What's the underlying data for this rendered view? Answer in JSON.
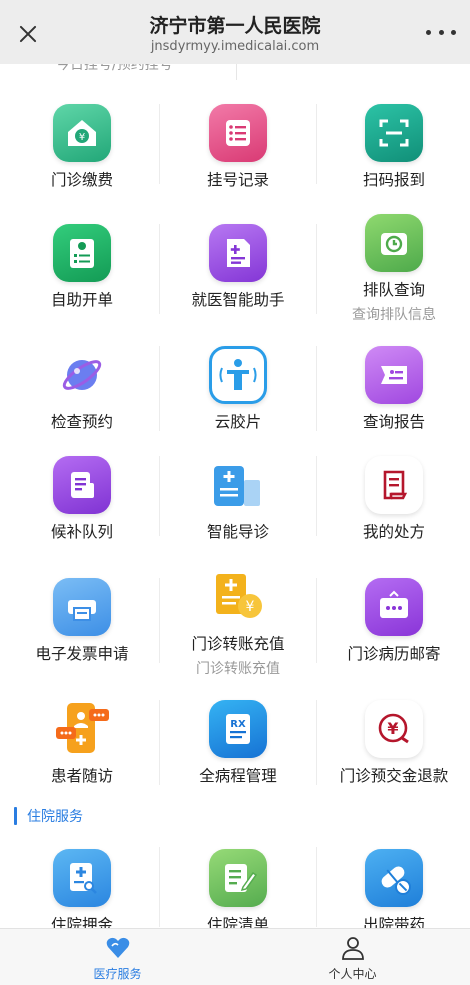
{
  "header": {
    "title": "济宁市第一人民医院",
    "url": "jnsdyrmyy.imedicalai.com"
  },
  "top_partial": {
    "text": "今日挂号/预约挂号"
  },
  "services": [
    {
      "label": "门诊缴费",
      "icon": "payment-house-icon",
      "color": "#3dbf8f"
    },
    {
      "label": "挂号记录",
      "icon": "record-list-icon",
      "color": "#e8538a"
    },
    {
      "label": "扫码报到",
      "icon": "scan-icon",
      "color": "#1aaa8e"
    },
    {
      "label": "自助开单",
      "icon": "checklist-card-icon",
      "color": "#22b066"
    },
    {
      "label": "就医智能助手",
      "icon": "document-plus-icon",
      "color": "#9a4ee3"
    },
    {
      "label": "排队查询",
      "sub": "查询排队信息",
      "icon": "clock-folder-icon",
      "color": "#6cc36b"
    },
    {
      "label": "检查预约",
      "icon": "planet-icon",
      "color": "#5b6ee8"
    },
    {
      "label": "云胶片",
      "icon": "body-scan-icon",
      "color": "#2a9de8"
    },
    {
      "label": "查询报告",
      "icon": "report-card-icon",
      "color": "#b25ee6"
    },
    {
      "label": "候补队列",
      "icon": "queue-document-icon",
      "color": "#9b48e0"
    },
    {
      "label": "智能导诊",
      "icon": "hospital-building-icon",
      "color": "#3b9ce8"
    },
    {
      "label": "我的处方",
      "icon": "prescription-icon",
      "color": "#c0392b"
    },
    {
      "label": "电子发票申请",
      "icon": "printer-icon",
      "color": "#3d8fe6"
    },
    {
      "label": "门诊转账充值",
      "sub": "门诊转账充值",
      "icon": "transfer-yen-icon",
      "color": "#f3b21c"
    },
    {
      "label": "门诊病历邮寄",
      "icon": "mailbox-icon",
      "color": "#9b3de0"
    },
    {
      "label": "患者随访",
      "icon": "follow-up-chat-icon",
      "color": "#f38b1c"
    },
    {
      "label": "全病程管理",
      "icon": "rx-clipboard-icon",
      "color": "#1e8fe0"
    },
    {
      "label": "门诊预交金退款",
      "icon": "refund-yen-icon",
      "color": "#c0243b"
    }
  ],
  "inpatient_section": {
    "title": "住院服务",
    "items": [
      {
        "label": "住院押金",
        "icon": "deposit-search-icon",
        "color": "#2b97e6"
      },
      {
        "label": "住院清单",
        "icon": "checklist-edit-icon",
        "color": "#6cc36b"
      },
      {
        "label": "出院带药",
        "icon": "pill-icon",
        "color": "#2b97e6"
      }
    ]
  },
  "tabbar": {
    "tabs": [
      {
        "label": "医疗服务",
        "icon": "heart-icon",
        "active": true,
        "color": "#2a7de1"
      },
      {
        "label": "个人中心",
        "icon": "person-icon",
        "active": false,
        "color": "#333333"
      }
    ]
  }
}
